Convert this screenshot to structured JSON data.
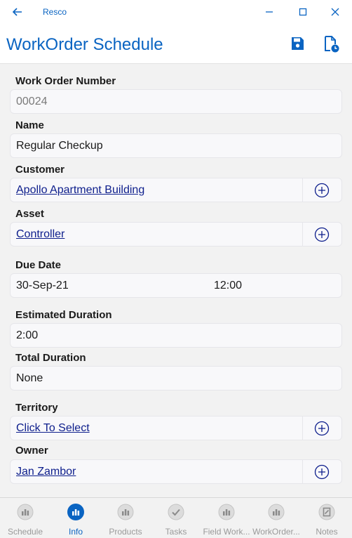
{
  "window": {
    "app_name": "Resco"
  },
  "header": {
    "title": "WorkOrder Schedule"
  },
  "fields": {
    "work_order_number": {
      "label": "Work Order Number",
      "value": "00024"
    },
    "name": {
      "label": "Name",
      "value": "Regular Checkup"
    },
    "customer": {
      "label": "Customer",
      "value": "Apollo Apartment Building"
    },
    "asset": {
      "label": "Asset",
      "value": "Controller"
    },
    "due_date": {
      "label": "Due Date",
      "date": "30-Sep-21",
      "time": "12:00"
    },
    "estimated_duration": {
      "label": "Estimated Duration",
      "value": "2:00"
    },
    "total_duration": {
      "label": "Total Duration",
      "value": "None"
    },
    "territory": {
      "label": "Territory",
      "value": "Click To Select"
    },
    "owner": {
      "label": "Owner",
      "value": "Jan Zambor"
    }
  },
  "nav": {
    "items": [
      {
        "label": "Schedule",
        "icon": "entity-icon"
      },
      {
        "label": "Info",
        "icon": "entity-icon",
        "active": true
      },
      {
        "label": "Products",
        "icon": "entity-icon"
      },
      {
        "label": "Tasks",
        "icon": "check-icon"
      },
      {
        "label": "Field Work...",
        "icon": "entity-icon"
      },
      {
        "label": "WorkOrder...",
        "icon": "entity-icon"
      },
      {
        "label": "Notes",
        "icon": "notes-icon"
      }
    ]
  },
  "colors": {
    "accent": "#0a64c2",
    "link": "#0d1e8c",
    "inactive": "#9a9a9a"
  }
}
